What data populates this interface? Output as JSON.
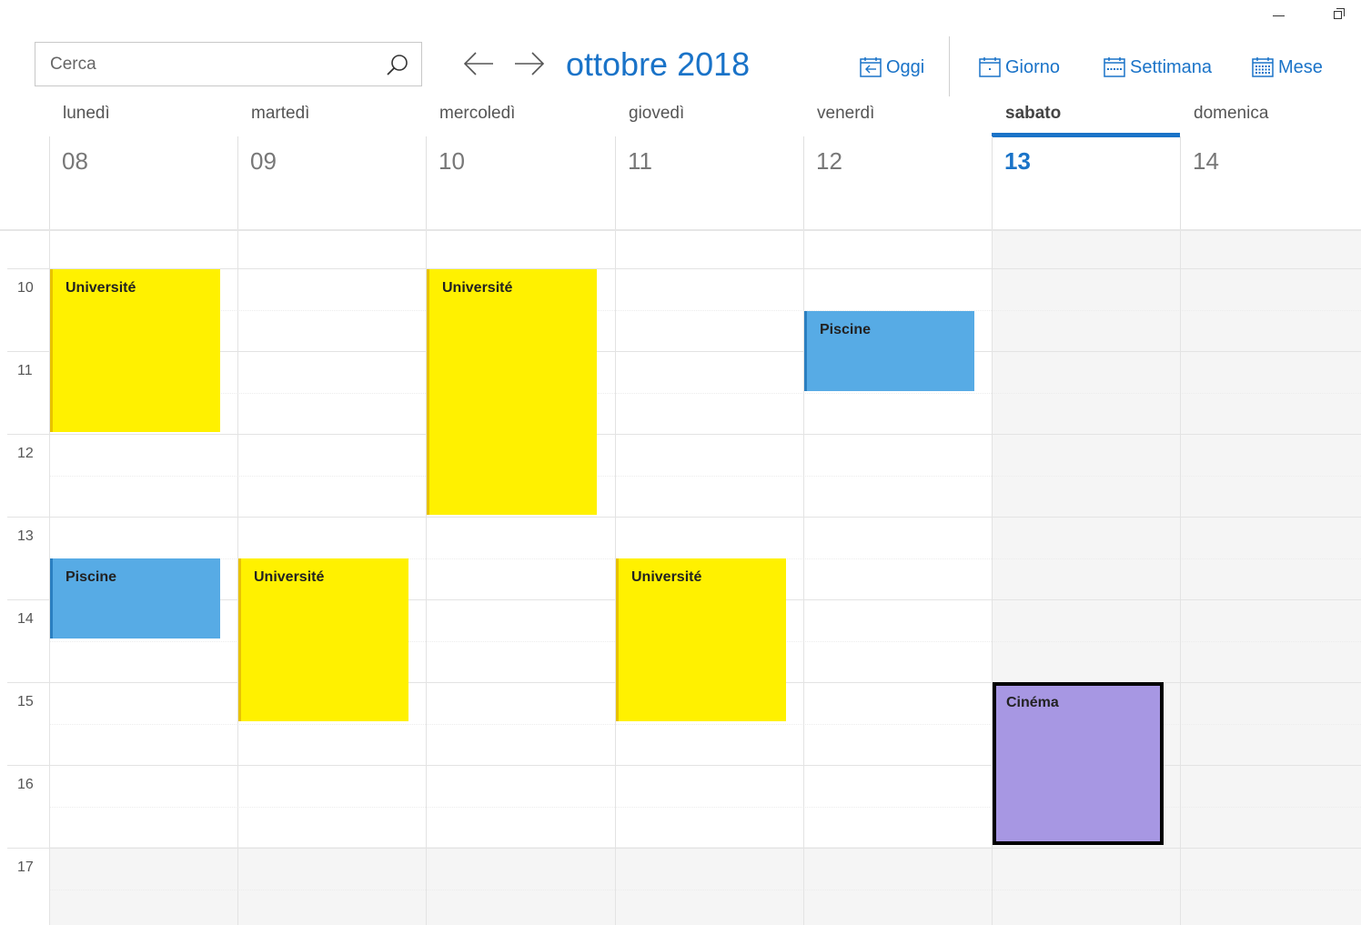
{
  "window": {
    "minimize_icon": "minimize-icon",
    "restore_icon": "restore-icon"
  },
  "search": {
    "placeholder": "Cerca",
    "icon": "search-icon"
  },
  "nav": {
    "month_title": "ottobre 2018",
    "prev_icon": "arrow-left-icon",
    "next_icon": "arrow-right-icon"
  },
  "toolbar": {
    "today_label": "Oggi",
    "day_label": "Giorno",
    "week_label": "Settimana",
    "month_label": "Mese"
  },
  "colors": {
    "accent": "#1a73c8",
    "yellow": "#fff100",
    "blue": "#57abe5",
    "purple": "#a797e3"
  },
  "weekdays": [
    {
      "name": "lunedì",
      "date": "08"
    },
    {
      "name": "martedì",
      "date": "09"
    },
    {
      "name": "mercoledì",
      "date": "10"
    },
    {
      "name": "giovedì",
      "date": "11"
    },
    {
      "name": "venerdì",
      "date": "12"
    },
    {
      "name": "sabato",
      "date": "13",
      "today": true
    },
    {
      "name": "domenica",
      "date": "14"
    }
  ],
  "hours": [
    "10",
    "11",
    "12",
    "13",
    "14",
    "15",
    "16",
    "17"
  ],
  "events": [
    {
      "title": "Université",
      "day": "lunedì",
      "start": "10:00",
      "end": "12:00",
      "color": "yellow"
    },
    {
      "title": "Université",
      "day": "mercoledì",
      "start": "10:00",
      "end": "13:00",
      "color": "yellow"
    },
    {
      "title": "Piscine",
      "day": "venerdì",
      "start": "10:30",
      "end": "11:30",
      "color": "blue"
    },
    {
      "title": "Piscine",
      "day": "lunedì",
      "start": "13:30",
      "end": "14:30",
      "color": "blue"
    },
    {
      "title": "Université",
      "day": "martedì",
      "start": "13:30",
      "end": "15:30",
      "color": "yellow"
    },
    {
      "title": "Université",
      "day": "giovedì",
      "start": "13:30",
      "end": "15:30",
      "color": "yellow"
    },
    {
      "title": "Cinéma",
      "day": "sabato",
      "start": "15:00",
      "end": "17:00",
      "color": "purple",
      "selected": true
    }
  ]
}
